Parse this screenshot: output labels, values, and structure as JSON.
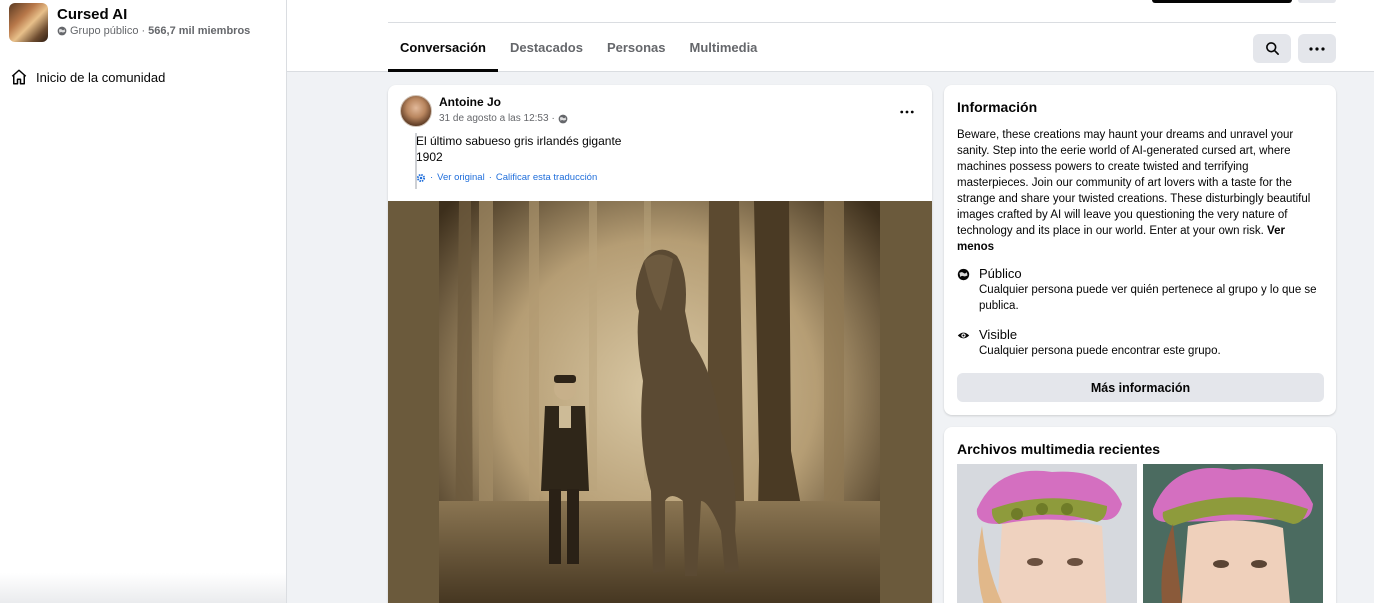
{
  "group": {
    "name": "Cursed AI",
    "privacy": "Grupo público",
    "separator": "·",
    "members": "566,7 mil miembros"
  },
  "sidebar": {
    "items": [
      {
        "label": "Inicio de la comunidad",
        "icon": "home-icon"
      }
    ]
  },
  "tabs": [
    {
      "label": "Conversación",
      "active": true
    },
    {
      "label": "Destacados",
      "active": false
    },
    {
      "label": "Personas",
      "active": false
    },
    {
      "label": "Multimedia",
      "active": false
    }
  ],
  "toolbar": {
    "search_icon": "search-icon",
    "more_icon": "more-horizontal-icon"
  },
  "post": {
    "author": "Antoine Jo",
    "time": "31 de agosto a las 12:53",
    "time_separator": "·",
    "privacy_icon": "globe-icon",
    "text_line1": "El último sabueso gris irlandés gigante",
    "text_line2": "1902",
    "translation": {
      "icon": "gear-icon",
      "prefix": "·",
      "see_original": "Ver original",
      "separator": "·",
      "rate": "Calificar esta traducción"
    }
  },
  "info": {
    "title": "Información",
    "description": "Beware, these creations may haunt your dreams and unravel your sanity. Step into the eerie world of AI-generated cursed art, where machines possess powers to create twisted and terrifying masterpieces. Join our community of art lovers with a taste for the strange and share your twisted creations. These disturbingly beautiful images crafted by AI will leave you questioning the very nature of technology and its place in our world. Enter at your own risk.",
    "see_less": "Ver menos",
    "public_title": "Público",
    "public_desc": "Cualquier persona puede ver quién pertenece al grupo y lo que se publica.",
    "visible_title": "Visible",
    "visible_desc": "Cualquier persona puede encontrar este grupo.",
    "more_button": "Más información"
  },
  "media": {
    "title": "Archivos multimedia recientes"
  },
  "colors": {
    "background": "#f0f2f5",
    "card": "#ffffff",
    "text_primary": "#050505",
    "text_secondary": "#65676b",
    "link": "#216fdb",
    "button_grey": "#e4e6eb"
  }
}
